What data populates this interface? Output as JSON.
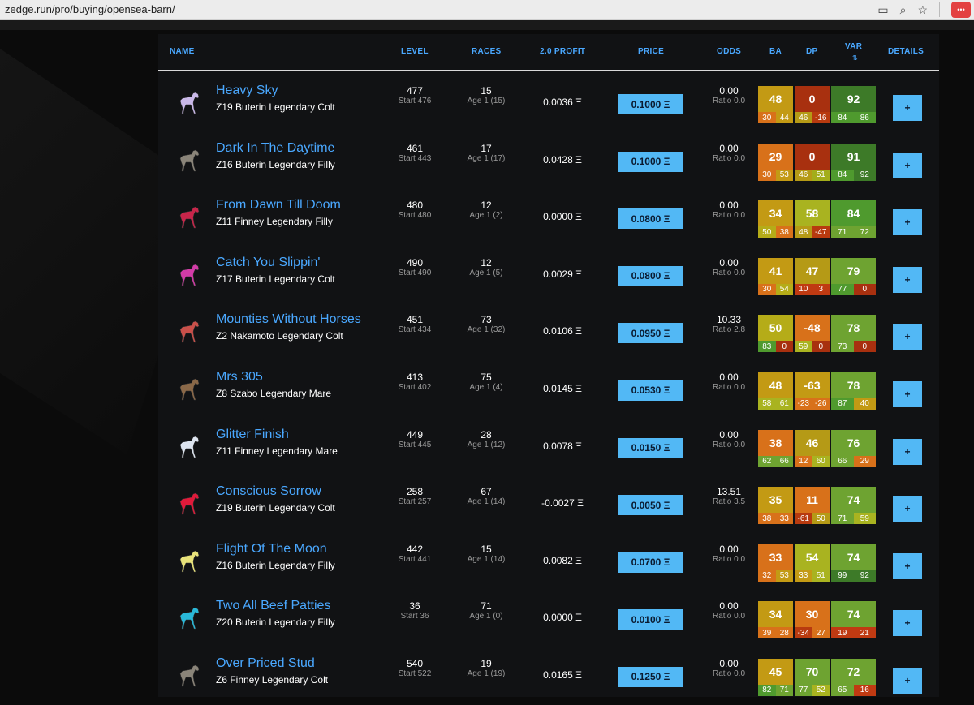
{
  "browser": {
    "url": "zedge.run/pro/buying/opensea-barn/"
  },
  "headers": {
    "name": "NAME",
    "level": "LEVEL",
    "races": "RACES",
    "profit": "2.0 PROFIT",
    "price": "PRICE",
    "odds": "ODDS",
    "ba": "BA",
    "dp": "DP",
    "var": "VAR",
    "details": "DETAILS"
  },
  "colors": {
    "accent": "#4aa8ff",
    "price_button": "#52b8f5"
  },
  "rows": [
    {
      "name": "Heavy Sky",
      "sub": "Z19 Buterin Legendary Colt",
      "horse_color": "#c9b8e8",
      "level": "477",
      "start": "Start 476",
      "races": "15",
      "age": "Age 1 (15)",
      "profit": "0.0036 Ξ",
      "price": "0.1000 Ξ",
      "odds": "0.00",
      "ratio": "Ratio 0.0",
      "ba": {
        "v": "48",
        "a": "30",
        "b": "44",
        "c": "#c39a14",
        "ca": "#d8711a",
        "cb": "#c39a14"
      },
      "dp": {
        "v": "0",
        "a": "46",
        "b": "-16",
        "c": "#a8300f",
        "ca": "#b59a16",
        "cb": "#b83a0f"
      },
      "var": {
        "v": "92",
        "a": "84",
        "b": "86",
        "c": "#3d7a28",
        "ca": "#4f9a2e",
        "cb": "#4f9a2e"
      },
      "details": "+"
    },
    {
      "name": "Dark In The Daytime",
      "sub": "Z16 Buterin Legendary Filly",
      "horse_color": "#8a8479",
      "level": "461",
      "start": "Start 443",
      "races": "17",
      "age": "Age 1 (17)",
      "profit": "0.0428 Ξ",
      "price": "0.1000 Ξ",
      "odds": "0.00",
      "ratio": "Ratio 0.0",
      "ba": {
        "v": "29",
        "a": "30",
        "b": "53",
        "c": "#d8711a",
        "ca": "#d8711a",
        "cb": "#c39a14"
      },
      "dp": {
        "v": "0",
        "a": "46",
        "b": "51",
        "c": "#a8300f",
        "ca": "#b59a16",
        "cb": "#a3ad1a"
      },
      "var": {
        "v": "91",
        "a": "84",
        "b": "92",
        "c": "#3d7a28",
        "ca": "#4f9a2e",
        "cb": "#3d7a28"
      },
      "details": "+"
    },
    {
      "name": "From Dawn Till Doom",
      "sub": "Z11 Finney Legendary Filly",
      "horse_color": "#c8254a",
      "level": "480",
      "start": "Start 480",
      "races": "12",
      "age": "Age 1 (2)",
      "profit": "0.0000 Ξ",
      "price": "0.0800 Ξ",
      "odds": "0.00",
      "ratio": "Ratio 0.0",
      "ba": {
        "v": "34",
        "a": "50",
        "b": "38",
        "c": "#c39a14",
        "ca": "#b5ac18",
        "cb": "#d8711a"
      },
      "dp": {
        "v": "58",
        "a": "48",
        "b": "-47",
        "c": "#a9b320",
        "ca": "#b59a16",
        "cb": "#b83a0f"
      },
      "var": {
        "v": "84",
        "a": "71",
        "b": "72",
        "c": "#4f9a2e",
        "ca": "#6ea331",
        "cb": "#6ea331"
      },
      "details": "+"
    },
    {
      "name": "Catch You Slippin'",
      "sub": "Z17 Buterin Legendary Colt",
      "horse_color": "#d23ba7",
      "level": "490",
      "start": "Start 490",
      "races": "12",
      "age": "Age 1 (5)",
      "profit": "0.0029 Ξ",
      "price": "0.0800 Ξ",
      "odds": "0.00",
      "ratio": "Ratio 0.0",
      "ba": {
        "v": "41",
        "a": "30",
        "b": "54",
        "c": "#c39a14",
        "ca": "#d8711a",
        "cb": "#b5ac18"
      },
      "dp": {
        "v": "47",
        "a": "10",
        "b": "3",
        "c": "#b59a16",
        "ca": "#c03a12",
        "cb": "#c03a12"
      },
      "var": {
        "v": "79",
        "a": "77",
        "b": "0",
        "c": "#6ea331",
        "ca": "#4f9a2e",
        "cb": "#a8300f"
      },
      "details": "+"
    },
    {
      "name": "Mounties Without Horses",
      "sub": "Z2 Nakamoto Legendary Colt",
      "horse_color": "#c9504a",
      "level": "451",
      "start": "Start 434",
      "races": "73",
      "age": "Age 1 (32)",
      "profit": "0.0106 Ξ",
      "price": "0.0950 Ξ",
      "odds": "10.33",
      "ratio": "Ratio 2.8",
      "ba": {
        "v": "50",
        "a": "83",
        "b": "0",
        "c": "#b5ac18",
        "ca": "#4f9a2e",
        "cb": "#a8300f"
      },
      "dp": {
        "v": "-48",
        "a": "59",
        "b": "0",
        "c": "#d8711a",
        "ca": "#a9b320",
        "cb": "#a8300f"
      },
      "var": {
        "v": "78",
        "a": "73",
        "b": "0",
        "c": "#6ea331",
        "ca": "#6ea331",
        "cb": "#a8300f"
      },
      "details": "+"
    },
    {
      "name": "Mrs 305",
      "sub": "Z8 Szabo Legendary Mare",
      "horse_color": "#8a6848",
      "level": "413",
      "start": "Start 402",
      "races": "75",
      "age": "Age 1 (4)",
      "profit": "0.0145 Ξ",
      "price": "0.0530 Ξ",
      "odds": "0.00",
      "ratio": "Ratio 0.0",
      "ba": {
        "v": "48",
        "a": "58",
        "b": "61",
        "c": "#c39a14",
        "ca": "#a9b320",
        "cb": "#a9b320"
      },
      "dp": {
        "v": "-63",
        "a": "-23",
        "b": "-26",
        "c": "#c39a14",
        "ca": "#d8711a",
        "cb": "#d8711a"
      },
      "var": {
        "v": "78",
        "a": "87",
        "b": "40",
        "c": "#6ea331",
        "ca": "#4f9a2e",
        "cb": "#c39a14"
      },
      "details": "+"
    },
    {
      "name": "Glitter Finish",
      "sub": "Z11 Finney Legendary Mare",
      "horse_color": "#dde4ef",
      "level": "449",
      "start": "Start 445",
      "races": "28",
      "age": "Age 1 (12)",
      "profit": "0.0078 Ξ",
      "price": "0.0150 Ξ",
      "odds": "0.00",
      "ratio": "Ratio 0.0",
      "ba": {
        "v": "38",
        "a": "62",
        "b": "66",
        "c": "#d8711a",
        "ca": "#6ea331",
        "cb": "#6ea331"
      },
      "dp": {
        "v": "46",
        "a": "12",
        "b": "60",
        "c": "#b59a16",
        "ca": "#d8711a",
        "cb": "#a9b320"
      },
      "var": {
        "v": "76",
        "a": "66",
        "b": "29",
        "c": "#6ea331",
        "ca": "#6ea331",
        "cb": "#d8711a"
      },
      "details": "+"
    },
    {
      "name": "Conscious Sorrow",
      "sub": "Z19 Buterin Legendary Colt",
      "horse_color": "#e01a3a",
      "level": "258",
      "start": "Start 257",
      "races": "67",
      "age": "Age 1 (14)",
      "profit": "-0.0027 Ξ",
      "price": "0.0050 Ξ",
      "odds": "13.51",
      "ratio": "Ratio 3.5",
      "ba": {
        "v": "35",
        "a": "38",
        "b": "33",
        "c": "#c39a14",
        "ca": "#d8711a",
        "cb": "#d8711a"
      },
      "dp": {
        "v": "11",
        "a": "-61",
        "b": "50",
        "c": "#d8711a",
        "ca": "#b83a0f",
        "cb": "#b59a16"
      },
      "var": {
        "v": "74",
        "a": "71",
        "b": "59",
        "c": "#6ea331",
        "ca": "#6ea331",
        "cb": "#a9b320"
      },
      "details": "+"
    },
    {
      "name": "Flight Of The Moon",
      "sub": "Z16 Buterin Legendary Filly",
      "horse_color": "#e8e27a",
      "level": "442",
      "start": "Start 441",
      "races": "15",
      "age": "Age 1 (14)",
      "profit": "0.0082 Ξ",
      "price": "0.0700 Ξ",
      "odds": "0.00",
      "ratio": "Ratio 0.0",
      "ba": {
        "v": "33",
        "a": "32",
        "b": "53",
        "c": "#d8711a",
        "ca": "#d8711a",
        "cb": "#c39a14"
      },
      "dp": {
        "v": "54",
        "a": "33",
        "b": "51",
        "c": "#a9b320",
        "ca": "#c39a14",
        "cb": "#a9b320"
      },
      "var": {
        "v": "74",
        "a": "99",
        "b": "92",
        "c": "#6ea331",
        "ca": "#3d7a28",
        "cb": "#3d7a28"
      },
      "details": "+"
    },
    {
      "name": "Two All Beef Patties",
      "sub": "Z20 Buterin Legendary Filly",
      "horse_color": "#29b8d8",
      "level": "36",
      "start": "Start 36",
      "races": "71",
      "age": "Age 1 (0)",
      "profit": "0.0000 Ξ",
      "price": "0.0100 Ξ",
      "odds": "0.00",
      "ratio": "Ratio 0.0",
      "ba": {
        "v": "34",
        "a": "39",
        "b": "28",
        "c": "#c39a14",
        "ca": "#d8711a",
        "cb": "#d8711a"
      },
      "dp": {
        "v": "30",
        "a": "-34",
        "b": "27",
        "c": "#d8711a",
        "ca": "#b83a0f",
        "cb": "#d8711a"
      },
      "var": {
        "v": "74",
        "a": "19",
        "b": "21",
        "c": "#6ea331",
        "ca": "#c03a12",
        "cb": "#c03a12"
      },
      "details": "+"
    },
    {
      "name": "Over Priced Stud",
      "sub": "Z6 Finney Legendary Colt",
      "horse_color": "#8a8479",
      "level": "540",
      "start": "Start 522",
      "races": "19",
      "age": "Age 1 (19)",
      "profit": "0.0165 Ξ",
      "price": "0.1250 Ξ",
      "odds": "0.00",
      "ratio": "Ratio 0.0",
      "ba": {
        "v": "45",
        "a": "82",
        "b": "71",
        "c": "#c39a14",
        "ca": "#4f9a2e",
        "cb": "#6ea331"
      },
      "dp": {
        "v": "70",
        "a": "77",
        "b": "52",
        "c": "#6ea331",
        "ca": "#6ea331",
        "cb": "#a9b320"
      },
      "var": {
        "v": "72",
        "a": "65",
        "b": "16",
        "c": "#6ea331",
        "ca": "#6ea331",
        "cb": "#c03a12"
      },
      "details": "+"
    }
  ]
}
